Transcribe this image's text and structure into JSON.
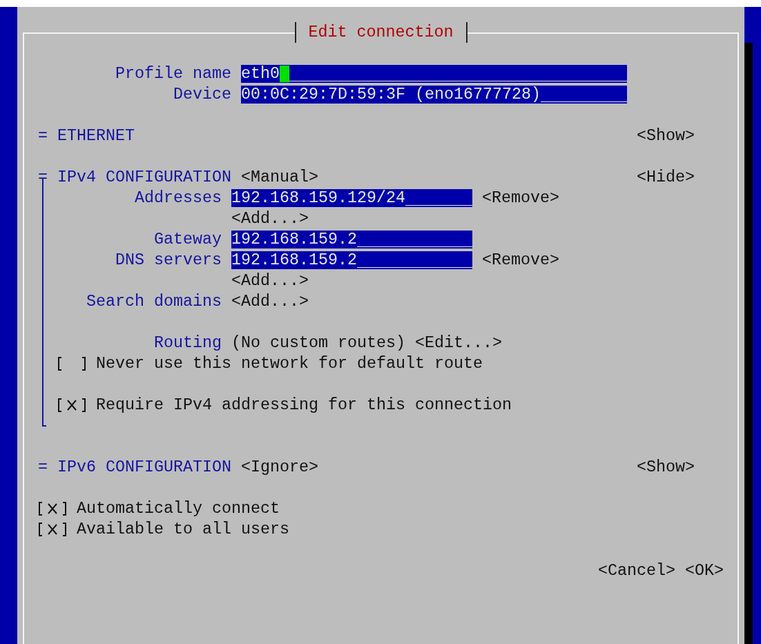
{
  "title": "Edit connection",
  "profile": {
    "label": "Profile name",
    "value": "eth0",
    "focused": true
  },
  "device": {
    "label": "Device",
    "value": "00:0C:29:7D:59:3F (eno16777728)",
    "focused": false
  },
  "sections_top": [
    {
      "marker": "=",
      "title": "ETHERNET",
      "toggle": "<Show>"
    }
  ],
  "ipv4": {
    "marker": "=",
    "title": "IPv4 CONFIGURATION",
    "mode": "<Manual>",
    "toggle": "<Hide>",
    "expanded": true,
    "rows": [
      {
        "kind": "field",
        "label": "Addresses",
        "value": "192.168.159.129/24",
        "action": "<Remove>"
      },
      {
        "kind": "button",
        "button": "<Add...>"
      },
      {
        "kind": "field",
        "label": "Gateway",
        "value": "192.168.159.2"
      },
      {
        "kind": "field",
        "label": "DNS servers",
        "value": "192.168.159.2",
        "action": "<Remove>"
      },
      {
        "kind": "button",
        "button": "<Add...>"
      },
      {
        "kind": "labeled_button",
        "label": "Search domains",
        "button": "<Add...>"
      },
      {
        "kind": "spacer"
      },
      {
        "kind": "routing",
        "label": "Routing",
        "value": "(No custom routes)",
        "button": "<Edit...>"
      },
      {
        "kind": "checkbox",
        "label": "Never use this network for default route",
        "checked": false
      },
      {
        "kind": "spacer"
      },
      {
        "kind": "checkbox",
        "label": "Require IPv4 addressing for this connection",
        "checked": true
      }
    ]
  },
  "ipv6": {
    "marker": "=",
    "title": "IPv6 CONFIGURATION",
    "mode": "<Ignore>",
    "toggle": "<Show>"
  },
  "options": [
    {
      "label": "Automatically connect",
      "checked": true
    },
    {
      "label": "Available to all users",
      "checked": true
    }
  ],
  "buttons": [
    "<Cancel>",
    "<OK>"
  ]
}
